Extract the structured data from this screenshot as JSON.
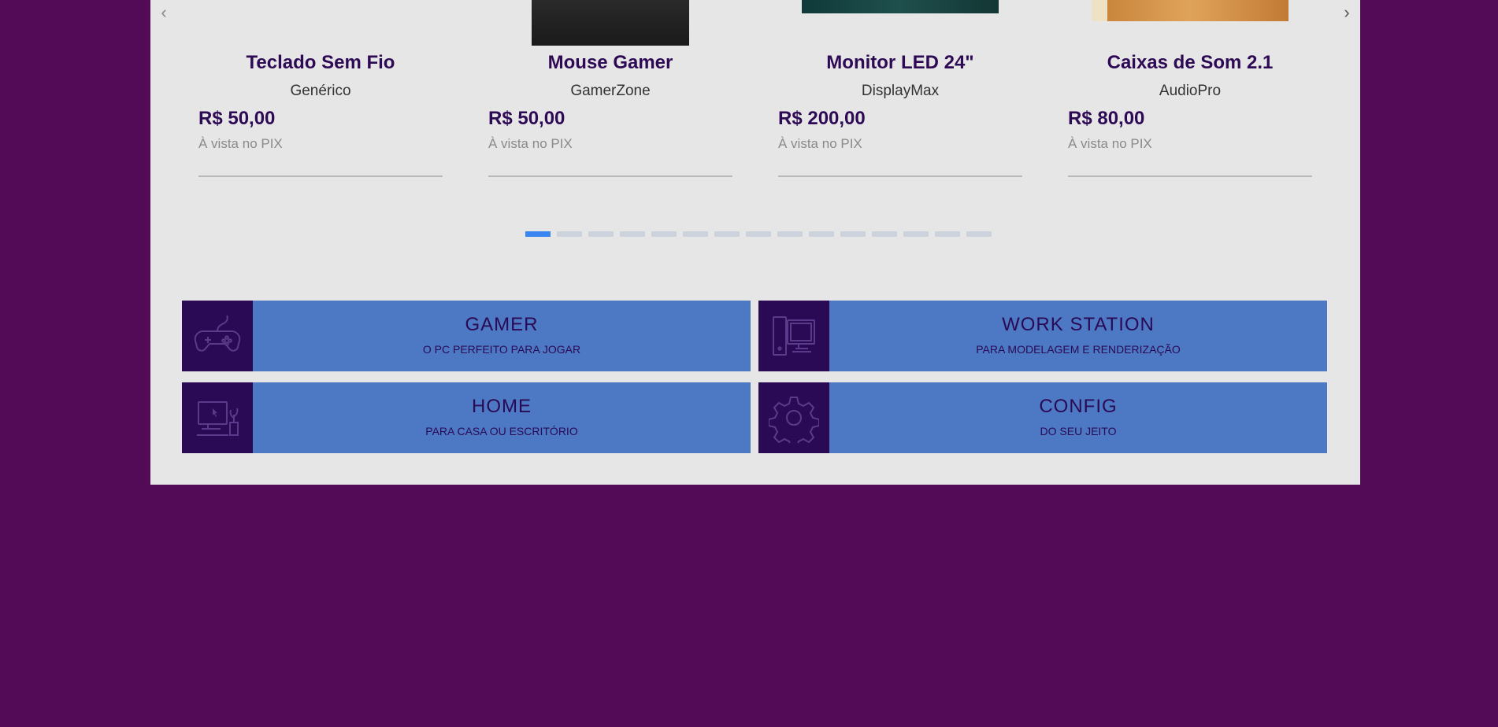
{
  "carousel": {
    "prev_icon": "chevron-left-icon",
    "next_icon": "chevron-right-icon",
    "products": [
      {
        "name": "Teclado Sem Fio",
        "brand": "Genérico",
        "price": "R$ 50,00",
        "payment": "À vista no PIX"
      },
      {
        "name": "Mouse Gamer",
        "brand": "GamerZone",
        "price": "R$ 50,00",
        "payment": "À vista no PIX"
      },
      {
        "name": "Monitor LED 24\"",
        "brand": "DisplayMax",
        "price": "R$ 200,00",
        "payment": "À vista no PIX"
      },
      {
        "name": "Caixas de Som 2.1",
        "brand": "AudioPro",
        "price": "R$ 80,00",
        "payment": "À vista no PIX"
      }
    ],
    "pagination": {
      "total": 15,
      "active_index": 0
    }
  },
  "categories": [
    {
      "title": "GAMER",
      "subtitle": "O PC PERFEITO PARA JOGAR",
      "icon": "gamepad-icon"
    },
    {
      "title": "WORK STATION",
      "subtitle": "PARA MODELAGEM E RENDERIZAÇÃO",
      "icon": "desktop-computer-icon"
    },
    {
      "title": "HOME",
      "subtitle": "PARA CASA OU ESCRITÓRIO",
      "icon": "home-desk-icon"
    },
    {
      "title": "CONFIG",
      "subtitle": "DO SEU JEITO",
      "icon": "gear-icon"
    }
  ],
  "colors": {
    "page_background": "#530b58",
    "panel_background": "#e6e6e6",
    "brand_dark": "#2e0a55",
    "category_blue": "#4c78c4",
    "active_dot": "#3a86f0"
  }
}
